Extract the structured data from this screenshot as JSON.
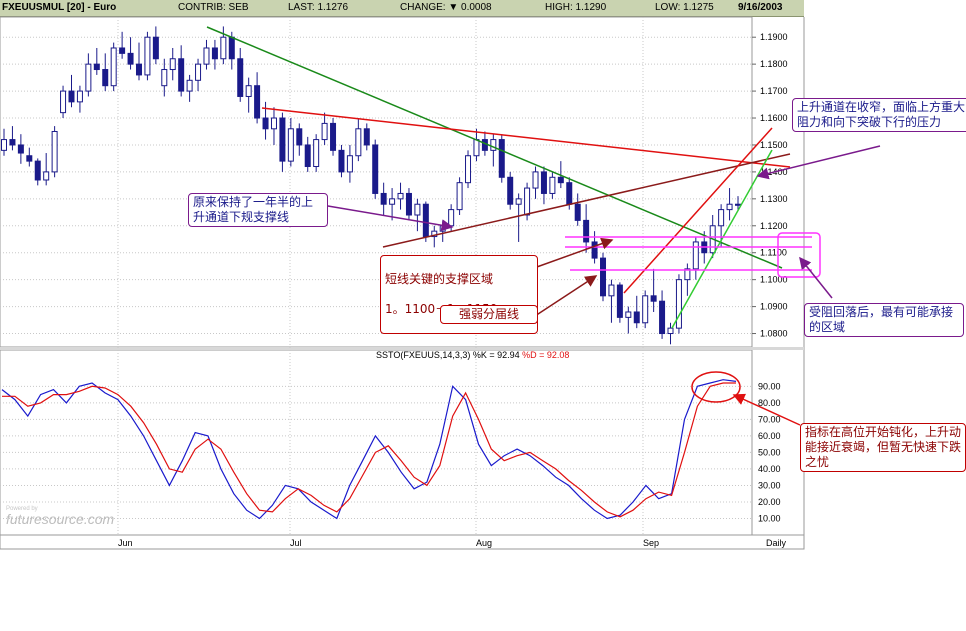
{
  "header": {
    "symbol": "FXEUUSMUL [20] - Euro",
    "contrib": "CONTRIB: SEB",
    "last": "LAST: 1.1276",
    "change": "CHANGE: ▼ 0.0008",
    "high": "HIGH: 1.1290",
    "low": "LOW: 1.1275",
    "date": "9/16/2003"
  },
  "colors": {
    "up": "#ffffff",
    "down": "#1a1a8a",
    "green": "#1a8a1a",
    "red": "#e01010",
    "darkred": "#8b1a1a",
    "magenta": "#ff33ff",
    "purple": "#7a1a8c"
  },
  "chart_data": [
    {
      "type": "candlestick",
      "ylim": [
        1.075,
        1.1975
      ],
      "yticks": [
        "1.1900",
        "1.1800",
        "1.1700",
        "1.1600",
        "1.1500",
        "1.1400",
        "1.1300",
        "1.1200",
        "1.1100",
        "1.1000",
        "1.0900",
        "1.0800"
      ],
      "xticks": [
        "Jun",
        "Jul",
        "Aug",
        "Sep",
        "Daily"
      ],
      "candles": [
        [
          1.148,
          1.156,
          1.146,
          1.152
        ],
        [
          1.152,
          1.157,
          1.148,
          1.15
        ],
        [
          1.15,
          1.154,
          1.143,
          1.147
        ],
        [
          1.146,
          1.149,
          1.142,
          1.144
        ],
        [
          1.144,
          1.145,
          1.135,
          1.137
        ],
        [
          1.137,
          1.147,
          1.135,
          1.14
        ],
        [
          1.14,
          1.157,
          1.138,
          1.155
        ],
        [
          1.162,
          1.172,
          1.16,
          1.17
        ],
        [
          1.17,
          1.176,
          1.164,
          1.166
        ],
        [
          1.166,
          1.172,
          1.162,
          1.17
        ],
        [
          1.17,
          1.184,
          1.168,
          1.18
        ],
        [
          1.18,
          1.186,
          1.176,
          1.178
        ],
        [
          1.178,
          1.184,
          1.17,
          1.172
        ],
        [
          1.172,
          1.188,
          1.17,
          1.186
        ],
        [
          1.186,
          1.192,
          1.182,
          1.184
        ],
        [
          1.184,
          1.19,
          1.178,
          1.18
        ],
        [
          1.18,
          1.188,
          1.174,
          1.176
        ],
        [
          1.176,
          1.192,
          1.174,
          1.19
        ],
        [
          1.19,
          1.194,
          1.18,
          1.182
        ],
        [
          1.172,
          1.182,
          1.168,
          1.178
        ],
        [
          1.178,
          1.186,
          1.174,
          1.182
        ],
        [
          1.182,
          1.187,
          1.168,
          1.17
        ],
        [
          1.17,
          1.176,
          1.166,
          1.174
        ],
        [
          1.174,
          1.182,
          1.17,
          1.18
        ],
        [
          1.18,
          1.189,
          1.178,
          1.186
        ],
        [
          1.186,
          1.189,
          1.178,
          1.182
        ],
        [
          1.182,
          1.194,
          1.18,
          1.19
        ],
        [
          1.19,
          1.192,
          1.178,
          1.182
        ],
        [
          1.182,
          1.186,
          1.166,
          1.168
        ],
        [
          1.168,
          1.175,
          1.162,
          1.172
        ],
        [
          1.172,
          1.177,
          1.158,
          1.16
        ],
        [
          1.16,
          1.166,
          1.152,
          1.156
        ],
        [
          1.156,
          1.164,
          1.15,
          1.16
        ],
        [
          1.16,
          1.162,
          1.14,
          1.144
        ],
        [
          1.144,
          1.16,
          1.142,
          1.156
        ],
        [
          1.156,
          1.158,
          1.146,
          1.15
        ],
        [
          1.15,
          1.153,
          1.14,
          1.142
        ],
        [
          1.142,
          1.154,
          1.14,
          1.152
        ],
        [
          1.152,
          1.162,
          1.15,
          1.158
        ],
        [
          1.158,
          1.16,
          1.146,
          1.148
        ],
        [
          1.148,
          1.15,
          1.138,
          1.14
        ],
        [
          1.14,
          1.15,
          1.136,
          1.146
        ],
        [
          1.146,
          1.16,
          1.144,
          1.156
        ],
        [
          1.156,
          1.158,
          1.148,
          1.15
        ],
        [
          1.15,
          1.152,
          1.13,
          1.132
        ],
        [
          1.132,
          1.136,
          1.124,
          1.128
        ],
        [
          1.128,
          1.134,
          1.122,
          1.13
        ],
        [
          1.13,
          1.136,
          1.126,
          1.132
        ],
        [
          1.132,
          1.134,
          1.122,
          1.124
        ],
        [
          1.124,
          1.13,
          1.118,
          1.128
        ],
        [
          1.128,
          1.129,
          1.114,
          1.116
        ],
        [
          1.116,
          1.12,
          1.112,
          1.118
        ],
        [
          1.118,
          1.122,
          1.114,
          1.12
        ],
        [
          1.12,
          1.128,
          1.118,
          1.126
        ],
        [
          1.126,
          1.138,
          1.124,
          1.136
        ],
        [
          1.136,
          1.148,
          1.134,
          1.146
        ],
        [
          1.146,
          1.156,
          1.144,
          1.152
        ],
        [
          1.152,
          1.155,
          1.146,
          1.148
        ],
        [
          1.148,
          1.154,
          1.142,
          1.152
        ],
        [
          1.152,
          1.154,
          1.136,
          1.138
        ],
        [
          1.138,
          1.14,
          1.126,
          1.128
        ],
        [
          1.128,
          1.132,
          1.114,
          1.13
        ],
        [
          1.124,
          1.136,
          1.122,
          1.134
        ],
        [
          1.134,
          1.142,
          1.13,
          1.14
        ],
        [
          1.14,
          1.142,
          1.128,
          1.132
        ],
        [
          1.132,
          1.14,
          1.13,
          1.138
        ],
        [
          1.138,
          1.144,
          1.134,
          1.136
        ],
        [
          1.136,
          1.138,
          1.126,
          1.128
        ],
        [
          1.128,
          1.132,
          1.12,
          1.122
        ],
        [
          1.122,
          1.128,
          1.11,
          1.114
        ],
        [
          1.114,
          1.118,
          1.106,
          1.108
        ],
        [
          1.108,
          1.11,
          1.092,
          1.094
        ],
        [
          1.094,
          1.1,
          1.084,
          1.098
        ],
        [
          1.098,
          1.099,
          1.084,
          1.086
        ],
        [
          1.086,
          1.09,
          1.08,
          1.088
        ],
        [
          1.088,
          1.094,
          1.082,
          1.084
        ],
        [
          1.084,
          1.096,
          1.082,
          1.094
        ],
        [
          1.094,
          1.104,
          1.088,
          1.092
        ],
        [
          1.092,
          1.096,
          1.078,
          1.08
        ],
        [
          1.08,
          1.084,
          1.076,
          1.082
        ],
        [
          1.082,
          1.102,
          1.08,
          1.1
        ],
        [
          1.1,
          1.106,
          1.094,
          1.104
        ],
        [
          1.104,
          1.116,
          1.1,
          1.114
        ],
        [
          1.114,
          1.118,
          1.106,
          1.11
        ],
        [
          1.11,
          1.124,
          1.108,
          1.12
        ],
        [
          1.12,
          1.128,
          1.112,
          1.126
        ],
        [
          1.126,
          1.134,
          1.122,
          1.128
        ],
        [
          1.128,
          1.131,
          1.126,
          1.1276
        ]
      ]
    },
    {
      "type": "line",
      "title": "SSTO(FXEUUS,14,3,3) %K = 92.94 %D = 92.08",
      "yticks": [
        "90.00",
        "80.00",
        "70.00",
        "60.00",
        "50.00",
        "40.00",
        "30.00",
        "20.00",
        "10.00"
      ],
      "ylim": [
        0,
        100
      ],
      "series": [
        {
          "name": "%K",
          "values": [
            88,
            82,
            72,
            85,
            88,
            80,
            90,
            92,
            86,
            82,
            72,
            60,
            45,
            30,
            45,
            62,
            60,
            40,
            25,
            15,
            10,
            18,
            30,
            28,
            20,
            15,
            10,
            30,
            45,
            60,
            50,
            38,
            28,
            32,
            55,
            90,
            82,
            55,
            42,
            48,
            52,
            48,
            42,
            35,
            30,
            22,
            15,
            10,
            12,
            20,
            30,
            22,
            25,
            70,
            90,
            92,
            94,
            93
          ]
        },
        {
          "name": "%D",
          "values": [
            84,
            84,
            78,
            80,
            85,
            85,
            87,
            90,
            89,
            85,
            78,
            68,
            55,
            40,
            38,
            52,
            58,
            52,
            38,
            25,
            15,
            14,
            22,
            28,
            24,
            18,
            14,
            22,
            36,
            50,
            54,
            45,
            35,
            30,
            42,
            72,
            86,
            70,
            52,
            45,
            48,
            50,
            45,
            40,
            33,
            27,
            20,
            14,
            11,
            15,
            22,
            26,
            24,
            50,
            78,
            90,
            92,
            92
          ]
        }
      ]
    }
  ],
  "annotations": {
    "channel_narrowing": "上升通道在收窄，面临上方重大阻力和向下突破下行的压力",
    "year_support": "原来保持了一年半的上升通道下规支撑线",
    "key_support": "短线关键的支撑区域",
    "key_support_range": "1。1100－1。1150",
    "divide_line": "强弱分届线",
    "pullback_zone": "受阻回落后，最有可能承接的区域",
    "indicator_note": "指标在高位开始钝化，上升动能接近衰竭，但暂无快速下跌之忧"
  },
  "watermark": "futuresource.com",
  "watermark_small": "Powered by"
}
